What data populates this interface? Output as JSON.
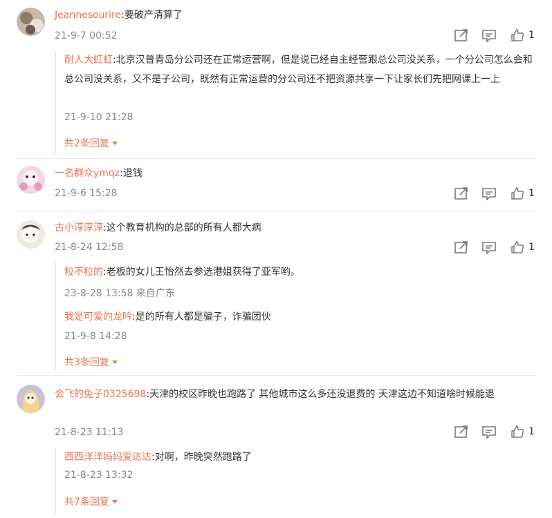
{
  "comments": [
    {
      "user": "Jeannesourire",
      "text": ":要破产清算了",
      "time": "21-9-7 00:52",
      "likes": "1",
      "replies": [
        {
          "user": "耐人大虹虹",
          "text": ":北京汉普青岛分公司还在正常运营啊，但是说已经自主经营跟总公司没关系，一个分公司怎么会和总公司没关系，又不是子公司，既然有正常运营的分公司还不把资源共享一下让家长们先把网课上一上",
          "time": "21-9-10 21:28"
        }
      ],
      "more": "共2条回复"
    },
    {
      "user": "一名群众ymqz",
      "text": ":退钱",
      "time": "21-9-6 15:28",
      "likes": "1",
      "replies": []
    },
    {
      "user": "古小淳淳淳",
      "text": ":这个教育机构的总部的所有人都大病",
      "time": "21-8-24 12:58",
      "likes": "1",
      "replies": [
        {
          "user": "粒不粒的",
          "text": ":老板的女儿王怡然去参选港姐获得了亚军哟。",
          "time": "23-8-28 13:58 来自广东"
        },
        {
          "user": "我是可爱的龙吟",
          "text": ":是的所有人都是骗子，诈骗团伙",
          "time": "21-9-8 14:28"
        }
      ],
      "more": "共3条回复"
    },
    {
      "user": "会飞的兔子0325698",
      "text": ":天津的校区昨晚也跑路了  其他城市这么多还没退费的 天津这边不知道啥时候能退",
      "time": "21-8-23 11:13",
      "likes": "1",
      "replies": [
        {
          "user": "西西洋洋妈妈爱达达",
          "text": ":对啊，昨晚突然跑路了",
          "time": "21-8-23 13:32"
        }
      ],
      "more": "共7条回复"
    }
  ],
  "icons": {
    "share": "share-icon",
    "comment": "comment-icon",
    "like": "thumbs-up-icon"
  },
  "colors": {
    "username": "#eb7350",
    "text": "#333333",
    "timestamp": "#888888",
    "icon": "#7a7a7a"
  }
}
